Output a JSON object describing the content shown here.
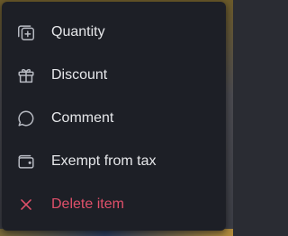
{
  "menu": {
    "items": [
      {
        "label": "Quantity",
        "icon": "quantity-icon"
      },
      {
        "label": "Discount",
        "icon": "gift-icon"
      },
      {
        "label": "Comment",
        "icon": "comment-icon"
      },
      {
        "label": "Exempt from tax",
        "icon": "wallet-icon"
      },
      {
        "label": "Delete item",
        "icon": "close-icon"
      }
    ]
  },
  "colors": {
    "menu_background": "#1d1f26",
    "text": "#e6e7ea",
    "icon": "#b9bcc4",
    "danger": "#e0506a"
  }
}
